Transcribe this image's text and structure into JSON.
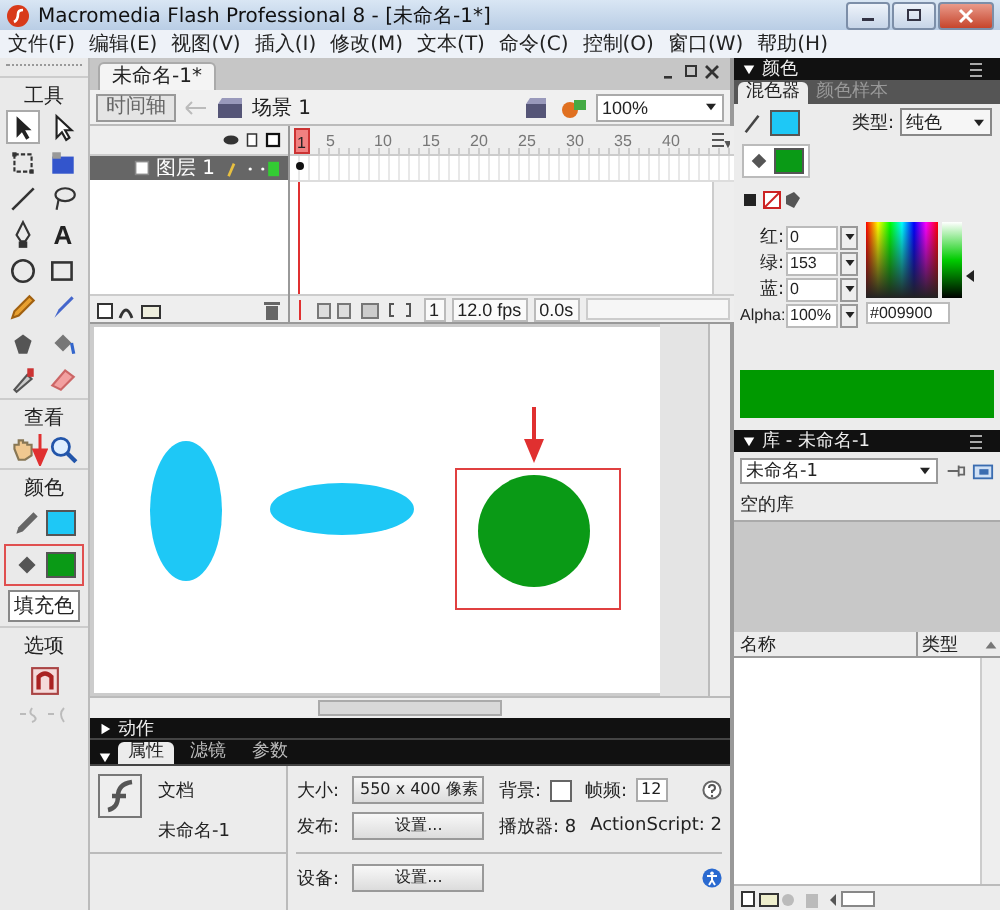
{
  "window": {
    "title": "Macromedia Flash Professional 8 - [未命名-1*]"
  },
  "menu": [
    "文件(F)",
    "编辑(E)",
    "视图(V)",
    "插入(I)",
    "修改(M)",
    "文本(T)",
    "命令(C)",
    "控制(O)",
    "窗口(W)",
    "帮助(H)"
  ],
  "tools": {
    "title": "工具",
    "text_tool": "A",
    "view_title": "查看",
    "color_title": "颜色",
    "tooltip": "填充色",
    "options_title": "选项"
  },
  "document": {
    "tab": "未命名-1*",
    "timeline_button": "时间轴",
    "scene": "场景 1",
    "zoom": "100%"
  },
  "timeline": {
    "ruler": [
      "1",
      "5",
      "10",
      "15",
      "20",
      "25",
      "30",
      "35",
      "40"
    ],
    "layers": [
      {
        "name": "图层 1",
        "selected": true
      }
    ],
    "frame": "1",
    "fps": "12.0 fps",
    "time": "0.0s"
  },
  "actions_panel": {
    "title": "动作",
    "expanded": false
  },
  "properties": {
    "tabs": [
      {
        "label": "属性",
        "selected": true
      },
      {
        "label": "滤镜",
        "selected": false
      },
      {
        "label": "参数",
        "selected": false
      }
    ],
    "type": "文档",
    "name": "未命名-1",
    "size_label": "大小:",
    "size_button": "550 x 400 像素",
    "background_label": "背景:",
    "frame_rate_label": "帧频:",
    "frame_rate": "12",
    "publish_label": "发布:",
    "publish_button": "设置...",
    "player": "播放器: 8",
    "actionscript": "ActionScript: 2",
    "device_label": "设备:",
    "device_button": "设置..."
  },
  "color_panel": {
    "title": "颜色",
    "tabs": [
      {
        "label": "混色器",
        "selected": true
      },
      {
        "label": "颜色样本",
        "selected": false
      }
    ],
    "type_label": "类型:",
    "type_value": "纯色",
    "channels": [
      {
        "label": "红:",
        "value": "0"
      },
      {
        "label": "绿:",
        "value": "153"
      },
      {
        "label": "蓝:",
        "value": "0"
      }
    ],
    "alpha_label": "Alpha:",
    "alpha_value": "100%",
    "hex": "#009900"
  },
  "library": {
    "title": "库 - 未命名-1",
    "document": "未命名-1",
    "status": "空的库",
    "columns": [
      "名称",
      "类型"
    ]
  }
}
